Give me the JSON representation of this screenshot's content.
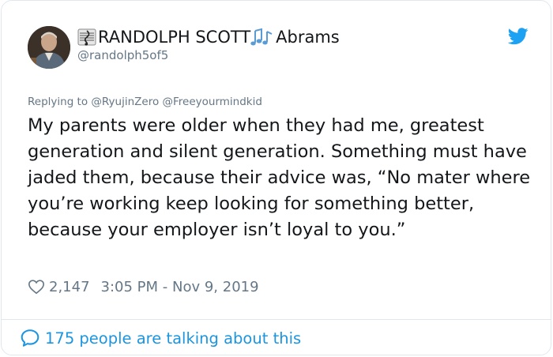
{
  "author": {
    "display_name_prefix": "RANDOLPH SCOTT",
    "display_name_suffix": "Abrams",
    "handle": "@randolph5of5",
    "emoji_left": "musical-score-icon",
    "emoji_right": "musical-notes-icon"
  },
  "reply": {
    "text": "Replying to @RyujinZero @Freeyourmindkid"
  },
  "tweet": {
    "text": "My parents were older when they had me, greatest generation and silent generation. Something must have jaded them, because their advice was, “No mater where you’re working keep looking for something better, because your employer isn’t loyal to you.”"
  },
  "meta": {
    "likes": "2,147",
    "timestamp": "3:05 PM - Nov 9, 2019"
  },
  "footer": {
    "talking": "175 people are talking about this"
  },
  "colors": {
    "accent": "#1b95e0",
    "twitter_blue": "#1da1f2",
    "secondary_text": "#657786",
    "border": "#e1e8ed"
  }
}
